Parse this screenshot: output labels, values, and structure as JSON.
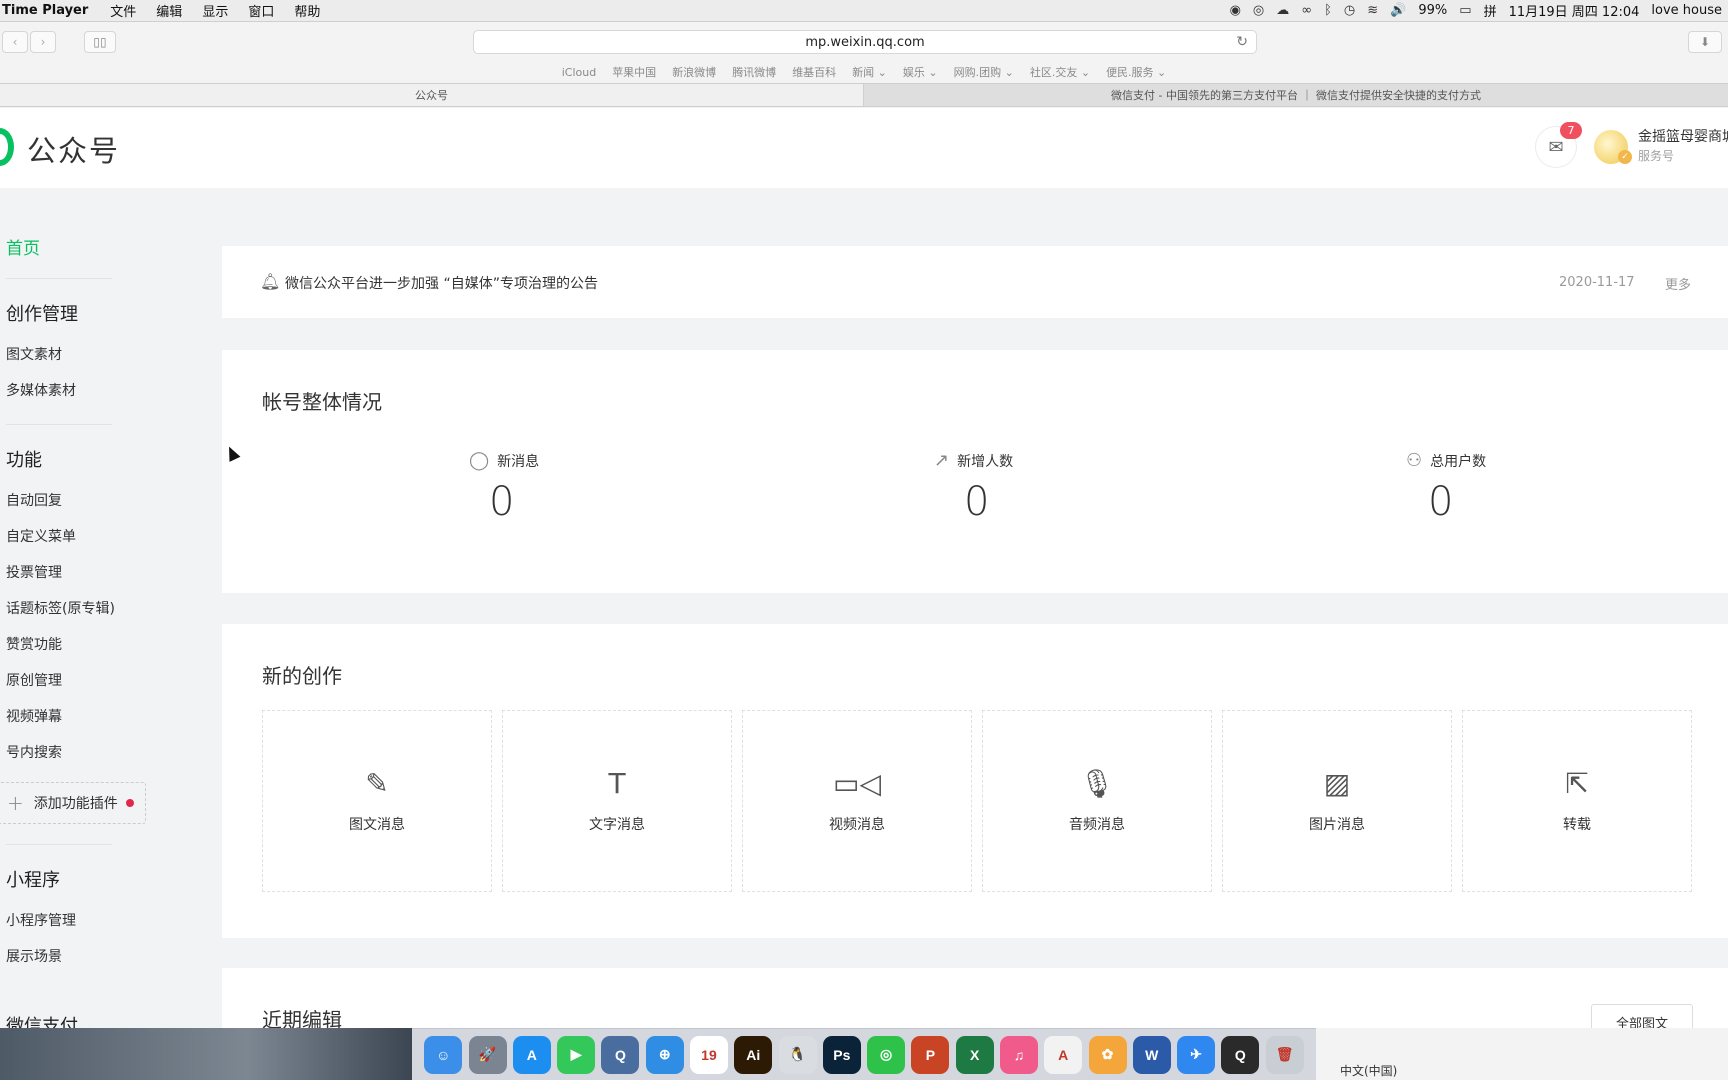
{
  "menubar": {
    "app_name": "Time Player",
    "menus": [
      "文件",
      "编辑",
      "显示",
      "窗口",
      "帮助"
    ],
    "battery": "99%",
    "ime": "拼",
    "datetime": "11月19日 周四 12:04",
    "user": "love house"
  },
  "browser": {
    "url": "mp.weixin.qq.com",
    "favorites": [
      "iCloud",
      "苹果中国",
      "新浪微博",
      "腾讯微博",
      "维基百科",
      "新闻 ⌄",
      "娱乐 ⌄",
      "网购.团购 ⌄",
      "社区.交友 ⌄",
      "便民.服务 ⌄"
    ],
    "tabs": [
      {
        "title": "公众号"
      },
      {
        "title": "微信支付 - 中国领先的第三方支付平台 ｜ 微信支付提供安全快捷的支付方式"
      }
    ]
  },
  "header": {
    "brand": "公众号",
    "mail_badge": "7",
    "account_name": "金摇篮母婴商城",
    "account_type": "服务号"
  },
  "sidebar": {
    "home": "首页",
    "section_create": "创作管理",
    "create_items": [
      "图文素材",
      "多媒体素材"
    ],
    "section_func": "功能",
    "func_items": [
      "自动回复",
      "自定义菜单",
      "投票管理",
      "话题标签(原专辑)",
      "赞赏功能",
      "原创管理",
      "视频弹幕",
      "号内搜索"
    ],
    "add_plugin": "添加功能插件",
    "section_mini": "小程序",
    "mini_items": [
      "小程序管理",
      "展示场景"
    ],
    "section_pay": "微信支付"
  },
  "notice": {
    "text": "微信公众平台进一步加强 “自媒体”专项治理的公告",
    "date": "2020-11-17",
    "more": "更多"
  },
  "overview": {
    "title": "帐号整体情况",
    "stats": [
      {
        "label": "新消息",
        "value": "0"
      },
      {
        "label": "新增人数",
        "value": "0"
      },
      {
        "label": "总用户数",
        "value": "0"
      }
    ]
  },
  "create": {
    "title": "新的创作",
    "cards": [
      "图文消息",
      "文字消息",
      "视频消息",
      "音频消息",
      "图片消息",
      "转载"
    ]
  },
  "recent": {
    "title": "近期编辑",
    "all_button": "全部图文"
  },
  "dock": {
    "language": "中文(中国)",
    "apps": [
      {
        "name": "Finder",
        "label": "☺",
        "color": "#3b8fe8"
      },
      {
        "name": "Launchpad",
        "label": "🚀",
        "color": "#7a8591"
      },
      {
        "name": "App Store",
        "label": "A",
        "color": "#1c8ef0"
      },
      {
        "name": "FaceTime",
        "label": "▶",
        "color": "#34c759"
      },
      {
        "name": "QuickTime",
        "label": "Q",
        "color": "#4a6da0"
      },
      {
        "name": "Safari",
        "label": "⊕",
        "color": "#2f8de4"
      },
      {
        "name": "Calendar",
        "label": "19",
        "color": "#ffffff"
      },
      {
        "name": "Illustrator",
        "label": "Ai",
        "color": "#2d1a05"
      },
      {
        "name": "QQ",
        "label": "🐧",
        "color": "#d9dde2"
      },
      {
        "name": "Photoshop",
        "label": "Ps",
        "color": "#0b2338"
      },
      {
        "name": "WeChat",
        "label": "◎",
        "color": "#2ec24a"
      },
      {
        "name": "PowerPoint",
        "label": "P",
        "color": "#c84424"
      },
      {
        "name": "Excel",
        "label": "X",
        "color": "#1e7a43"
      },
      {
        "name": "iTunes",
        "label": "♫",
        "color": "#f05b8c"
      },
      {
        "name": "Acrobat",
        "label": "A",
        "color": "#f2f2f2"
      },
      {
        "name": "Photos",
        "label": "✿",
        "color": "#f4a63b"
      },
      {
        "name": "Word",
        "label": "W",
        "color": "#2b5aa8"
      },
      {
        "name": "Feishu",
        "label": "✈",
        "color": "#2f88f0"
      },
      {
        "name": "QuickTime Player",
        "label": "Q",
        "color": "#2a2a2a"
      },
      {
        "name": "Trash",
        "label": "🗑",
        "color": "#c9ced4"
      }
    ]
  }
}
